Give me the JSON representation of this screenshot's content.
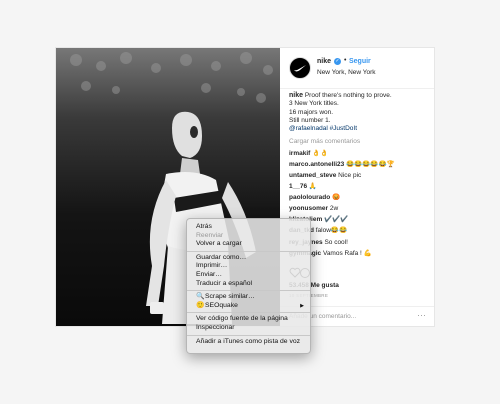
{
  "post": {
    "username": "nike",
    "follow_label": "Seguir",
    "location": "New York, New York",
    "caption_lines": [
      "Proof there's nothing to prove.",
      "3 New York titles.",
      "16 majors won.",
      "Still number 1.",
      "@rafaelnadal #JustDoIt"
    ],
    "load_more": "Cargar más comentarios",
    "comments": [
      {
        "user": "irmakif",
        "text": "👌👌"
      },
      {
        "user": "marco.antonelli23",
        "text": "😂😂😂😂😂🏆"
      },
      {
        "user": "untamed_steve",
        "text": "Nice pic"
      },
      {
        "user": "1__76",
        "text": "🙏"
      },
      {
        "user": "paololourado",
        "text": "😡"
      },
      {
        "user": "yoonusomer",
        "text": "2w"
      },
      {
        "user": "klizatoliem",
        "text": "✔️✔️✔️"
      },
      {
        "user": "dan_tkd",
        "text": "falow😂😂"
      },
      {
        "user": "rey_jaynes",
        "text": "So cool!"
      },
      {
        "user": "gymmagic",
        "text": "Vamos Rafa ! 💪"
      }
    ],
    "likes": "53.458 Me gusta",
    "date": "10 SEPTIEMBRE",
    "add_comment_placeholder": "Añade un comentario...",
    "more_icon": "···"
  },
  "context_menu": {
    "items": [
      {
        "label": "Atrás",
        "enabled": true
      },
      {
        "label": "Reenviar",
        "enabled": false
      },
      {
        "label": "Volver a cargar",
        "enabled": true
      },
      {
        "label": "Guardar como…",
        "enabled": true
      },
      {
        "label": "Imprimir…",
        "enabled": true
      },
      {
        "label": "Enviar…",
        "enabled": true
      },
      {
        "label": "Traducir a español",
        "enabled": true
      },
      {
        "label": "Scrape similar…",
        "enabled": true,
        "icon": "scraper-icon"
      },
      {
        "label": "SEOquake",
        "enabled": true,
        "icon": "seoquake-icon",
        "submenu": true
      },
      {
        "label": "Ver código fuente de la página",
        "enabled": true
      },
      {
        "label": "Inspeccionar",
        "enabled": true
      },
      {
        "label": "Añadir a iTunes como pista de voz",
        "enabled": true
      }
    ]
  },
  "colors": {
    "link_blue": "#3897f0",
    "hashtag_blue": "#003569",
    "muted_gray": "#999999"
  }
}
